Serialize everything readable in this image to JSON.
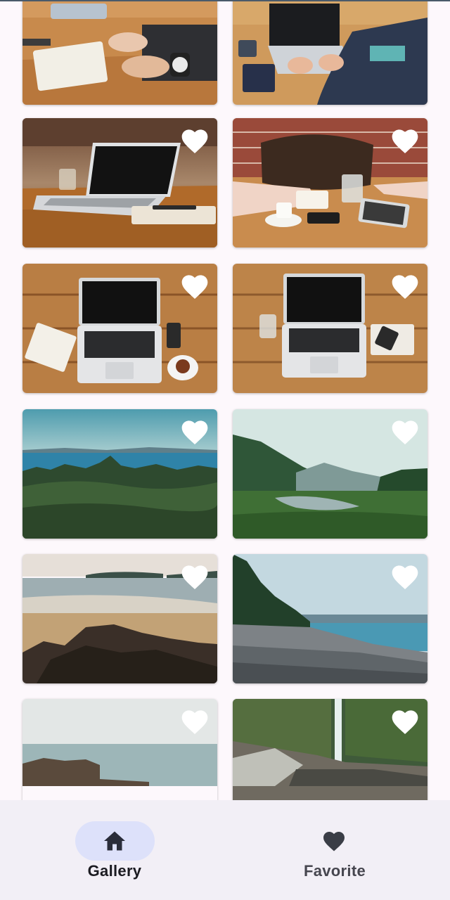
{
  "colors": {
    "background": "#fdf8fc",
    "navbar_bg": "#f2eff6",
    "active_pill": "#dde1fa",
    "active_text": "#1b1b21",
    "inactive_text": "#46464f",
    "icon_dark": "#2a2d3a",
    "heart": "#ffffff"
  },
  "gallery": {
    "items": [
      {
        "scene": "desk-notebook-watch",
        "favorite_icon": false
      },
      {
        "scene": "desk-laptop-typing",
        "favorite_icon": false
      },
      {
        "scene": "laptop-on-wooden-table",
        "favorite_icon": true
      },
      {
        "scene": "cafe-table-bag-tablet",
        "favorite_icon": true
      },
      {
        "scene": "laptop-notebook-coffee-topdown",
        "favorite_icon": true
      },
      {
        "scene": "laptop-glass-phone-topdown",
        "favorite_icon": true
      },
      {
        "scene": "forest-and-sea",
        "favorite_icon": true
      },
      {
        "scene": "misty-valley-river",
        "favorite_icon": true
      },
      {
        "scene": "rocky-beach-islands",
        "favorite_icon": true
      },
      {
        "scene": "pebble-shore-pines",
        "favorite_icon": true
      },
      {
        "scene": "calm-sea-rocks",
        "favorite_icon": true
      },
      {
        "scene": "waterfall-gorge",
        "favorite_icon": true
      }
    ]
  },
  "navbar": {
    "items": [
      {
        "label": "Gallery",
        "icon": "home-icon",
        "selected": true
      },
      {
        "label": "Favorite",
        "icon": "heart-icon",
        "selected": false
      }
    ]
  }
}
